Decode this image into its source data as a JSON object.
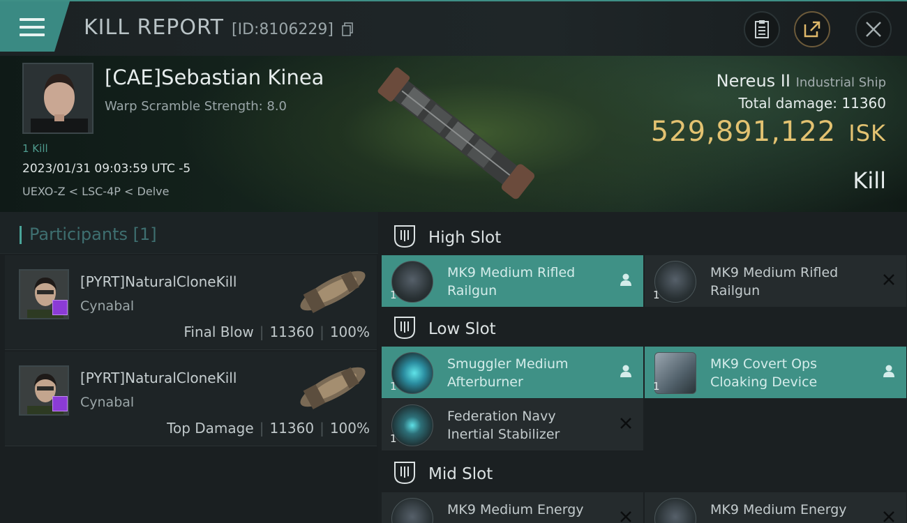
{
  "header": {
    "title": "KILL REPORT",
    "report_id": "[ID:8106229]"
  },
  "victim": {
    "name": "[CAE]Sebastian Kinea",
    "warp_scramble": "Warp Scramble Strength: 8.0",
    "kill_count": "1 Kill",
    "timestamp": "2023/01/31 09:03:59 UTC -5",
    "location": "UEXO-Z < LSC-4P < Delve",
    "ship_name": "Nereus II",
    "ship_class": "Industrial Ship",
    "total_damage_label": "Total damage:",
    "total_damage_value": "11360",
    "isk_value": "529,891,122",
    "isk_unit": "ISK",
    "result": "Kill"
  },
  "participants": {
    "label": "Participants [1]",
    "items": [
      {
        "name": "[PYRT]NaturalCloneKill",
        "ship": "Cynabal",
        "role": "Final Blow",
        "damage": "11360",
        "percent": "100%"
      },
      {
        "name": "[PYRT]NaturalCloneKill",
        "ship": "Cynabal",
        "role": "Top Damage",
        "damage": "11360",
        "percent": "100%"
      }
    ]
  },
  "slots": {
    "high": {
      "title": "High Slot",
      "modules": [
        {
          "name_line1": "MK9 Medium Rifled",
          "name_line2": "Railgun",
          "qty": "1",
          "status": "dropped"
        },
        {
          "name_line1": "MK9 Medium Rifled",
          "name_line2": "Railgun",
          "qty": "1",
          "status": "destroyed"
        }
      ]
    },
    "low": {
      "title": "Low Slot",
      "modules": [
        {
          "name_line1": "Smuggler Medium",
          "name_line2": "Afterburner",
          "qty": "1",
          "status": "dropped"
        },
        {
          "name_line1": "MK9 Covert Ops",
          "name_line2": "Cloaking Device",
          "qty": "1",
          "status": "dropped"
        },
        {
          "name_line1": "Federation Navy",
          "name_line2": "Inertial Stabilizer",
          "qty": "1",
          "status": "destroyed"
        }
      ]
    },
    "mid": {
      "title": "Mid Slot",
      "modules": [
        {
          "name_line1": "MK9 Medium Energy",
          "name_line2": "",
          "qty": "",
          "status": "destroyed"
        },
        {
          "name_line1": "MK9 Medium Energy",
          "name_line2": "",
          "qty": "",
          "status": "destroyed"
        }
      ]
    }
  },
  "colors": {
    "accent": "#3f9186",
    "isk": "#e3c271",
    "badge": "#8b3bd6"
  }
}
